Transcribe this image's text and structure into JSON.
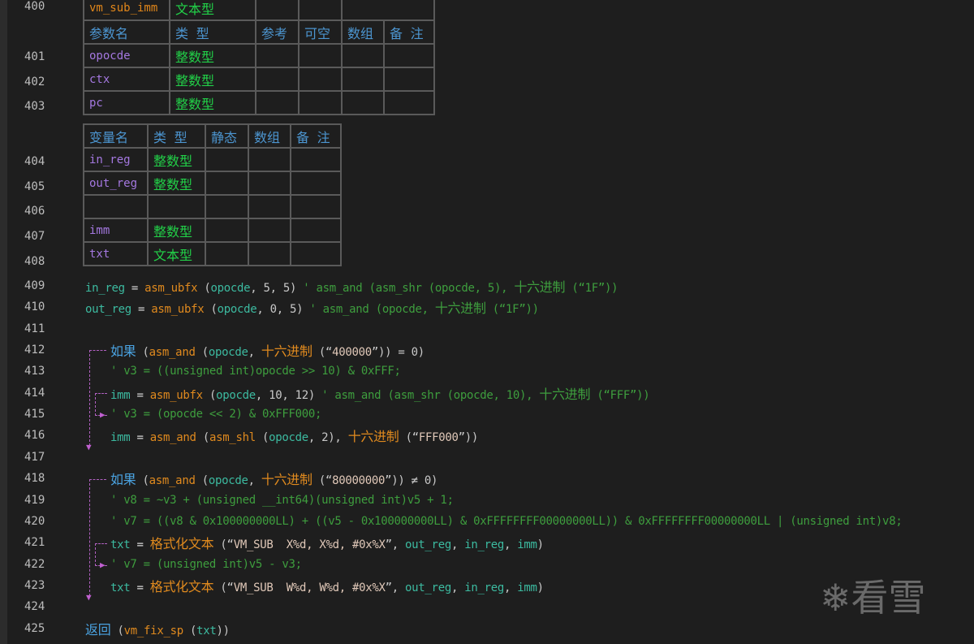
{
  "sub_table": {
    "name": "vm_sub_imm",
    "type": "文本型",
    "headers": [
      "参数名",
      "类 型",
      "参考",
      "可空",
      "数组",
      "备 注"
    ],
    "params": [
      {
        "name": "opocde",
        "type": "整数型"
      },
      {
        "name": "ctx",
        "type": "整数型"
      },
      {
        "name": "pc",
        "type": "整数型"
      }
    ]
  },
  "var_table": {
    "headers": [
      "变量名",
      "类 型",
      "静态",
      "数组",
      "备 注"
    ],
    "vars": [
      {
        "name": "in_reg",
        "type": "整数型"
      },
      {
        "name": "out_reg",
        "type": "整数型"
      },
      {
        "name": "",
        "type": ""
      },
      {
        "name": "imm",
        "type": "整数型"
      },
      {
        "name": "txt",
        "type": "文本型"
      }
    ]
  },
  "table_line_numbers": [
    "400",
    "401",
    "402",
    "403",
    "404",
    "405",
    "406",
    "407",
    "408"
  ],
  "code_lines": [
    {
      "num": "409",
      "tokens": [
        [
          "var",
          "in_reg"
        ],
        [
          "op",
          " = "
        ],
        [
          "fn",
          "asm_ubfx"
        ],
        [
          "pl",
          " ("
        ],
        [
          "var",
          "opocde"
        ],
        [
          "pl",
          ", 5, 5) "
        ],
        [
          "cm",
          "' asm_and (asm_shr (opocde, 5), "
        ],
        [
          "cmcn",
          "十六进制"
        ],
        [
          "cm",
          " (“1F”))"
        ]
      ]
    },
    {
      "num": "410",
      "tokens": [
        [
          "var",
          "out_reg"
        ],
        [
          "op",
          " = "
        ],
        [
          "fn",
          "asm_ubfx"
        ],
        [
          "pl",
          " ("
        ],
        [
          "var",
          "opocde"
        ],
        [
          "pl",
          ", 0, 5) "
        ],
        [
          "cm",
          "' asm_and (opocde, "
        ],
        [
          "cmcn",
          "十六进制"
        ],
        [
          "cm",
          " (“1F”))"
        ]
      ]
    },
    {
      "num": "411",
      "tokens": []
    },
    {
      "num": "412",
      "tokens": [
        [
          "kw",
          "如果"
        ],
        [
          "pl",
          " ("
        ],
        [
          "fn",
          "asm_and"
        ],
        [
          "pl",
          " ("
        ],
        [
          "var",
          "opocde"
        ],
        [
          "pl",
          ", "
        ],
        [
          "cn",
          "十六进制"
        ],
        [
          "pl",
          " (“"
        ],
        [
          "str",
          "400000"
        ],
        [
          "pl",
          "”)) = 0)"
        ]
      ]
    },
    {
      "num": "413",
      "tokens": [
        [
          "cm",
          "' v3 = ((unsigned int)opocde >> 10) & 0xFFF;"
        ]
      ]
    },
    {
      "num": "414",
      "tokens": [
        [
          "var",
          "imm"
        ],
        [
          "op",
          " = "
        ],
        [
          "fn",
          "asm_ubfx"
        ],
        [
          "pl",
          " ("
        ],
        [
          "var",
          "opocde"
        ],
        [
          "pl",
          ", 10, 12) "
        ],
        [
          "cm",
          "' asm_and (asm_shr (opocde, 10), "
        ],
        [
          "cmcn",
          "十六进制"
        ],
        [
          "cm",
          " (“FFF”))"
        ]
      ]
    },
    {
      "num": "415",
      "tokens": [
        [
          "cm",
          "' v3 = (opocde << 2) & 0xFFF000;"
        ]
      ]
    },
    {
      "num": "416",
      "tokens": [
        [
          "var",
          "imm"
        ],
        [
          "op",
          " = "
        ],
        [
          "fn",
          "asm_and"
        ],
        [
          "pl",
          " ("
        ],
        [
          "fn",
          "asm_shl"
        ],
        [
          "pl",
          " ("
        ],
        [
          "var",
          "opocde"
        ],
        [
          "pl",
          ", 2), "
        ],
        [
          "cn",
          "十六进制"
        ],
        [
          "pl",
          " (“"
        ],
        [
          "str",
          "FFF000"
        ],
        [
          "pl",
          "”))"
        ]
      ]
    },
    {
      "num": "417",
      "tokens": []
    },
    {
      "num": "418",
      "tokens": [
        [
          "kw",
          "如果"
        ],
        [
          "pl",
          " ("
        ],
        [
          "fn",
          "asm_and"
        ],
        [
          "pl",
          " ("
        ],
        [
          "var",
          "opocde"
        ],
        [
          "pl",
          ", "
        ],
        [
          "cn",
          "十六进制"
        ],
        [
          "pl",
          " (“"
        ],
        [
          "str",
          "80000000"
        ],
        [
          "pl",
          "”)) ≠ 0)"
        ]
      ]
    },
    {
      "num": "419",
      "tokens": [
        [
          "cm",
          "' v8 = ~v3 + (unsigned __int64)(unsigned int)v5 + 1;"
        ]
      ]
    },
    {
      "num": "420",
      "tokens": [
        [
          "cm",
          "' v7 = ((v8 & 0x100000000LL) + ((v5 - 0x100000000LL) & 0xFFFFFFFF00000000LL)) & 0xFFFFFFFF00000000LL | (unsigned int)v8;"
        ]
      ]
    },
    {
      "num": "421",
      "tokens": [
        [
          "var",
          "txt"
        ],
        [
          "op",
          " = "
        ],
        [
          "cn",
          "格式化文本"
        ],
        [
          "pl",
          " (“"
        ],
        [
          "str",
          "VM_SUB  X%d, X%d, #0x%X"
        ],
        [
          "pl",
          "”, "
        ],
        [
          "var",
          "out_reg"
        ],
        [
          "pl",
          ", "
        ],
        [
          "var",
          "in_reg"
        ],
        [
          "pl",
          ", "
        ],
        [
          "var",
          "imm"
        ],
        [
          "pl",
          ")"
        ]
      ]
    },
    {
      "num": "422",
      "tokens": [
        [
          "cm",
          "' v7 = (unsigned int)v5 - v3;"
        ]
      ]
    },
    {
      "num": "423",
      "tokens": [
        [
          "var",
          "txt"
        ],
        [
          "op",
          " = "
        ],
        [
          "cn",
          "格式化文本"
        ],
        [
          "pl",
          " (“"
        ],
        [
          "str",
          "VM_SUB  W%d, W%d, #0x%X"
        ],
        [
          "pl",
          "”, "
        ],
        [
          "var",
          "out_reg"
        ],
        [
          "pl",
          ", "
        ],
        [
          "var",
          "in_reg"
        ],
        [
          "pl",
          ", "
        ],
        [
          "var",
          "imm"
        ],
        [
          "pl",
          ")"
        ]
      ]
    },
    {
      "num": "424",
      "tokens": []
    },
    {
      "num": "425",
      "tokens": [
        [
          "kw",
          "返回"
        ],
        [
          "pl",
          " ("
        ],
        [
          "fn",
          "vm_fix_sp"
        ],
        [
          "pl",
          " ("
        ],
        [
          "var",
          "txt"
        ],
        [
          "pl",
          "))"
        ]
      ]
    }
  ],
  "watermark": "看雪",
  "colors": {
    "background": "#1e1e1e",
    "flow_line": "#b060c0",
    "type": "#22d048",
    "header": "#4c95d0"
  }
}
